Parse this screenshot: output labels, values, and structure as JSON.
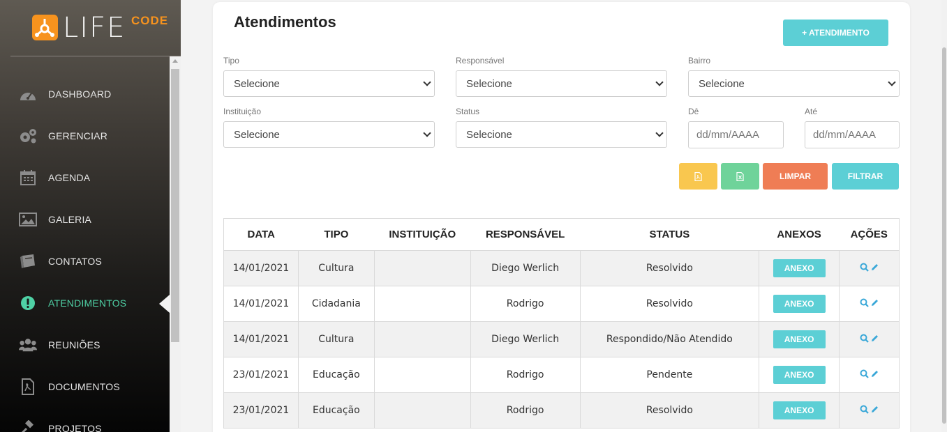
{
  "brand": {
    "name": "LIFE",
    "code": "CODE",
    "accent": "#f7931e"
  },
  "sidebar": {
    "items": [
      {
        "label": "DASHBOARD",
        "icon": "dashboard-icon"
      },
      {
        "label": "GERENCIAR",
        "icon": "gears-icon"
      },
      {
        "label": "AGENDA",
        "icon": "calendar-icon"
      },
      {
        "label": "GALERIA",
        "icon": "image-icon"
      },
      {
        "label": "CONTATOS",
        "icon": "book-icon"
      },
      {
        "label": "ATENDIMENTOS",
        "icon": "exclamation-icon",
        "active": true
      },
      {
        "label": "REUNIÕES",
        "icon": "users-icon"
      },
      {
        "label": "DOCUMENTOS",
        "icon": "pdf-file-icon"
      },
      {
        "label": "PROJETOS",
        "icon": "gavel-icon"
      }
    ]
  },
  "page": {
    "title": "Atendimentos",
    "add_button": "+ ATENDIMENTO"
  },
  "filters": {
    "tipo": {
      "label": "Tipo",
      "value": "Selecione"
    },
    "responsavel": {
      "label": "Responsável",
      "value": "Selecione"
    },
    "bairro": {
      "label": "Bairro",
      "value": "Selecione"
    },
    "instituicao": {
      "label": "Instituição",
      "value": "Selecione"
    },
    "status": {
      "label": "Status",
      "value": "Selecione"
    },
    "de": {
      "label": "Dê",
      "placeholder": "dd/mm/AAAA"
    },
    "ate": {
      "label": "Até",
      "placeholder": "dd/mm/AAAA"
    }
  },
  "actions": {
    "pdf_icon": "pdf-icon",
    "excel_icon": "excel-icon",
    "limpar": "LIMPAR",
    "filtrar": "FILTRAR"
  },
  "colors": {
    "teal": "#5ccfd5",
    "yellow": "#f9c74f",
    "green": "#6fd39a",
    "orange": "#ef7d55",
    "active_menu": "#4fd1a5"
  },
  "table": {
    "headers": [
      "DATA",
      "TIPO",
      "INSTITUIÇÃO",
      "RESPONSÁVEL",
      "STATUS",
      "ANEXOS",
      "AÇÕES"
    ],
    "anexo_label": "ANEXO",
    "rows": [
      {
        "data": "14/01/2021",
        "tipo": "Cultura",
        "instituicao": "",
        "responsavel": "Diego Werlich",
        "status": "Resolvido"
      },
      {
        "data": "14/01/2021",
        "tipo": "Cidadania",
        "instituicao": "",
        "responsavel": "Rodrigo",
        "status": "Resolvido"
      },
      {
        "data": "14/01/2021",
        "tipo": "Cultura",
        "instituicao": "",
        "responsavel": "Diego Werlich",
        "status": "Respondido/Não Atendido"
      },
      {
        "data": "23/01/2021",
        "tipo": "Educação",
        "instituicao": "",
        "responsavel": "Rodrigo",
        "status": "Pendente"
      },
      {
        "data": "23/01/2021",
        "tipo": "Educação",
        "instituicao": "",
        "responsavel": "Rodrigo",
        "status": "Resolvido"
      }
    ]
  }
}
